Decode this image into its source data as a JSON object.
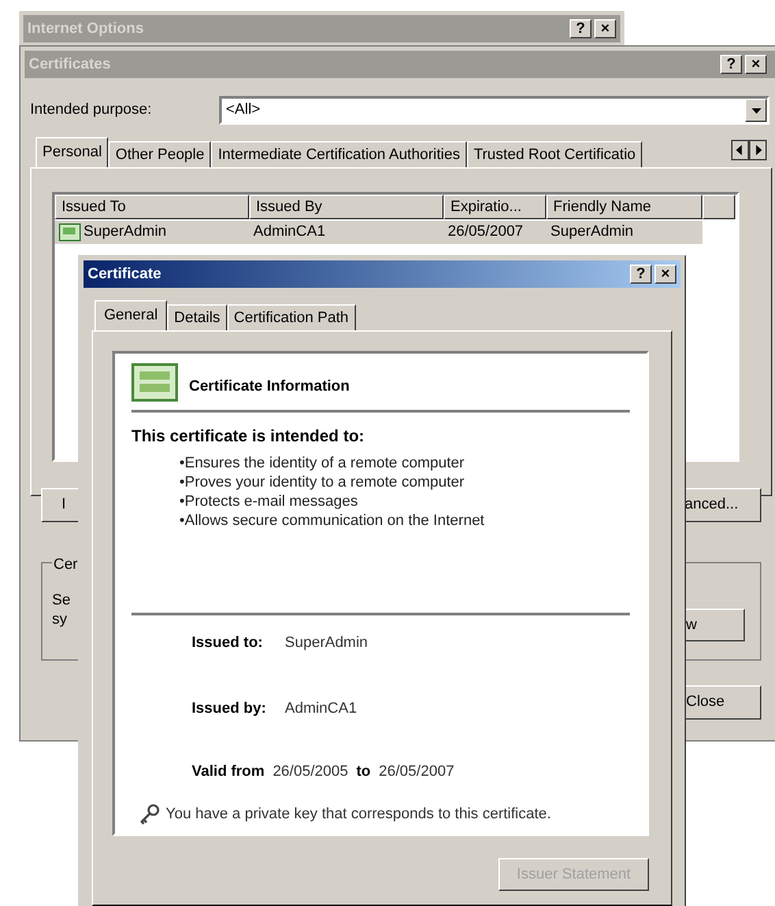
{
  "internet_options": {
    "title": "Internet Options",
    "title_buttons": [
      "?",
      "×"
    ]
  },
  "certificates": {
    "title": "Certificates",
    "title_buttons": [
      "?",
      "×"
    ],
    "intended_purpose_label": "Intended purpose:",
    "intended_purpose_value": "<All>",
    "tabs": [
      {
        "label": "Personal",
        "selected": true
      },
      {
        "label": "Other People",
        "selected": false
      },
      {
        "label": "Intermediate Certification Authorities",
        "selected": false
      },
      {
        "label": "Trusted Root Certificatio",
        "selected": false
      }
    ],
    "columns": [
      "Issued To",
      "Issued By",
      "Expiratio...",
      "Friendly Name"
    ],
    "rows": [
      {
        "cells": [
          "SuperAdmin",
          "AdminCA1",
          "26/05/2007",
          "SuperAdmin"
        ],
        "selected": true
      }
    ],
    "left_button": "I",
    "right_button": "anced...",
    "group_label": "Cer",
    "group_text": [
      "Se",
      "sy"
    ],
    "group_button": "w",
    "close_button": "Close"
  },
  "certificate": {
    "title": "Certificate",
    "title_buttons": [
      "?",
      "×"
    ],
    "tabs": [
      {
        "label": "General",
        "selected": true
      },
      {
        "label": "Details",
        "selected": false
      },
      {
        "label": "Certification Path",
        "selected": false
      }
    ],
    "heading": "Certificate Information",
    "intended_heading": "This certificate is intended to:",
    "purposes": [
      "•Ensures the identity of a remote computer",
      "•Proves your identity to a remote computer",
      "•Protects e-mail messages",
      "•Allows secure communication on the Internet"
    ],
    "issued_to_label": "Issued to:",
    "issued_to": "SuperAdmin",
    "issued_by_label": "Issued by:",
    "issued_by": "AdminCA1",
    "valid_from_label": "Valid from",
    "valid_from": "26/05/2005",
    "valid_to_label": "to",
    "valid_to": "26/05/2007",
    "key_note": "You have a private key that corresponds to this certificate.",
    "issuer_button": {
      "label": "Issuer Statement",
      "disabled": true
    }
  }
}
